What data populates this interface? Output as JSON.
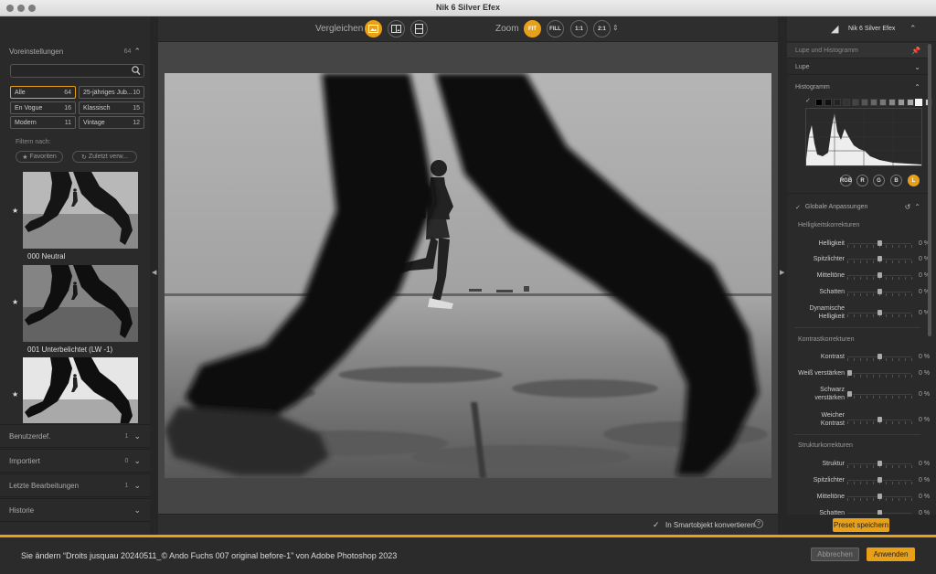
{
  "window": {
    "title": "Nik 6 Silver Efex"
  },
  "left": {
    "presets": {
      "label": "Voreinstellungen",
      "count": "64"
    },
    "search": {
      "placeholder": "",
      "value": ""
    },
    "filters": [
      {
        "label": "Alle",
        "count": "64",
        "selected": true
      },
      {
        "label": "25-jähriges Jub...",
        "count": "10",
        "selected": false
      },
      {
        "label": "En Vogue",
        "count": "16",
        "selected": false
      },
      {
        "label": "Klassisch",
        "count": "15",
        "selected": false
      },
      {
        "label": "Modern",
        "count": "11",
        "selected": false
      },
      {
        "label": "Vintage",
        "count": "12",
        "selected": false
      }
    ],
    "filter_by": "Filtern nach:",
    "favorites": "Favoriten",
    "recent": "Zuletzt verw...",
    "thumbs": [
      {
        "label": "000 Neutral"
      },
      {
        "label": "001 Unterbelichtet (LW -1)"
      },
      {
        "label": ""
      }
    ],
    "sections": [
      {
        "label": "Benutzerdef.",
        "count": "1"
      },
      {
        "label": "Importiert",
        "count": "0"
      },
      {
        "label": "Letzte Bearbeitungen",
        "count": "1"
      },
      {
        "label": "Historie",
        "count": ""
      }
    ]
  },
  "center": {
    "compare": "Vergleichen",
    "zoom": "Zoom",
    "zoom_buttons": [
      "FIT",
      "FILL",
      "1:1",
      "2:1"
    ],
    "smart_object": "In Smartobjekt konvertieren",
    "help": "?"
  },
  "right": {
    "app_name": "Nik 6 Silver Efex",
    "loupe_histogram": "Lupe und Histogramm",
    "loupe": "Lupe",
    "histogram": "Histogramm",
    "channels": [
      "RGB",
      "R",
      "G",
      "B",
      "L"
    ],
    "global": "Globale Anpassungen",
    "groups": [
      {
        "title": "Helligkeitskorrekturen",
        "items": [
          {
            "label": "Helligkeit",
            "value": "0 %"
          },
          {
            "label": "Spitzlichter",
            "value": "0 %"
          },
          {
            "label": "Mitteltöne",
            "value": "0 %"
          },
          {
            "label": "Schatten",
            "value": "0 %"
          },
          {
            "label": "Dynamische\nHelligkeit",
            "value": "0 %"
          }
        ]
      },
      {
        "title": "Kontrastkorrekturen",
        "items": [
          {
            "label": "Kontrast",
            "value": "0 %"
          },
          {
            "label": "Weiß verstärken",
            "value": "0 %"
          },
          {
            "label": "Schwarz\nverstärken",
            "value": "0 %"
          },
          {
            "label": "Weicher\nKontrast",
            "value": "0 %"
          }
        ]
      },
      {
        "title": "Strukturkorrekturen",
        "items": [
          {
            "label": "Struktur",
            "value": "0 %"
          },
          {
            "label": "Spitzlichter",
            "value": "0 %"
          },
          {
            "label": "Mitteltöne",
            "value": "0 %"
          },
          {
            "label": "Schatten",
            "value": "0 %"
          }
        ]
      }
    ],
    "save_preset": "Preset speichern"
  },
  "bottom": {
    "message": "Sie ändern “Droits jusquau 20240511_© Ando Fuchs 007 original before-1” von Adobe Photoshop 2023",
    "cancel": "Abbrechen",
    "apply": "Anwenden"
  },
  "colors": {
    "accent": "#e8a018"
  }
}
